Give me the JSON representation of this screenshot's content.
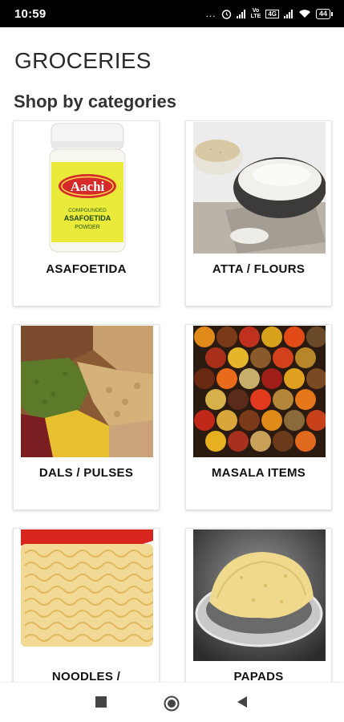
{
  "status_bar": {
    "time": "10:59",
    "dots": "...",
    "vo_line1": "Vo",
    "vo_line2": "LTE",
    "lte": "4G",
    "battery": "44"
  },
  "page": {
    "title": "GROCERIES",
    "section_title": "Shop by categories"
  },
  "categories": [
    {
      "label": "ASAFOETIDA",
      "image": "aachi-asafoetida-jar",
      "brand": "Aachi",
      "product_line1": "COMPOUNDED",
      "product_line2": "ASAFOETIDA",
      "product_line3": "POWDER"
    },
    {
      "label": "ATTA / FLOURS",
      "image": "flour-bowls"
    },
    {
      "label": "DALS / PULSES",
      "image": "mixed-pulses"
    },
    {
      "label": "MASALA ITEMS",
      "image": "spice-bowls"
    },
    {
      "label": "NOODLES /",
      "image": "instant-noodles"
    },
    {
      "label": "PAPADS",
      "image": "papad-in-bowl"
    }
  ],
  "colors": {
    "status_bar_bg": "#000000",
    "card_border": "#e6e6e6",
    "text": "#111111"
  },
  "nav": {
    "recent_icon": "square-icon",
    "home_icon": "circle-icon",
    "back_icon": "triangle-back-icon"
  }
}
